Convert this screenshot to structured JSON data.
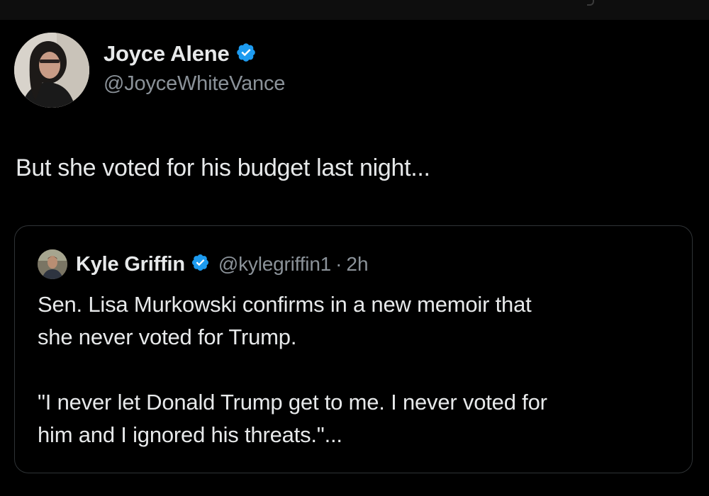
{
  "tweet": {
    "author": {
      "name": "Joyce Alene",
      "handle": "@JoyceWhiteVance",
      "verified": true
    },
    "text": "But she voted for his budget last night..."
  },
  "quoted_tweet": {
    "author": {
      "name": "Kyle Griffin",
      "handle": "@kylegriffin1",
      "verified": true
    },
    "separator": "·",
    "time": "2h",
    "paragraph1_line1": "Sen. Lisa Murkowski confirms in a new memoir that",
    "paragraph1_line2": "she never voted for Trump.",
    "paragraph2_line1": "\"I never let Donald Trump get to me. I never voted for",
    "paragraph2_line2": "him and I ignored his threats.\"..."
  },
  "colors": {
    "background": "#000000",
    "text_primary": "#e7e9ea",
    "text_secondary": "#8b9299",
    "border": "#2f3336",
    "verified_blue": "#1d9bf0"
  },
  "icons": {
    "verified": "verified-badge-icon"
  }
}
